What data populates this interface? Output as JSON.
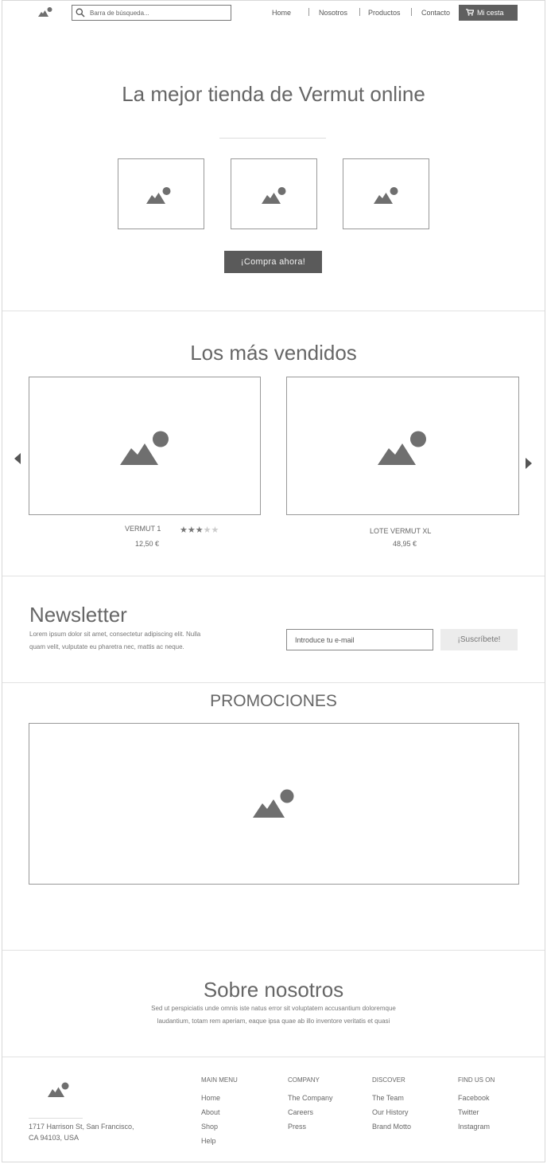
{
  "header": {
    "logo_icon": "image-placeholder-icon",
    "search_placeholder": "Barra de búsqueda...",
    "nav": [
      "Home",
      "Nosotros",
      "Productos",
      "Contacto"
    ],
    "cart_label": "Mi cesta",
    "cart_icon": "cart-icon"
  },
  "hero": {
    "title": "La mejor tienda de Vermut online",
    "cta": "¡Compra ahora!"
  },
  "bestsellers": {
    "title": "Los más vendidos",
    "products": [
      {
        "name": "VERMUT 1",
        "price": "12,50 €",
        "rating": 3,
        "rating_max": 5
      },
      {
        "name": "LOTE VERMUT XL",
        "price": "48,95 €"
      }
    ]
  },
  "newsletter": {
    "title": "Newsletter",
    "text_line1": "Lorem ipsum dolor sit amet, consectetur adipiscing elit. Nulla",
    "text_line2": "quam velit, vulputate eu pharetra nec, mattis ac neque.",
    "email_placeholder": "Introduce tu e-mail",
    "subscribe_label": "¡Suscríbete!"
  },
  "promos": {
    "title": "PROMOCIONES"
  },
  "about": {
    "title": "Sobre nosotros",
    "line1": "Sed ut perspiciatis unde omnis iste natus error sit voluptatem accusantium doloremque",
    "line2": "laudantium, totam rem aperiam, eaque ipsa quae ab illo inventore veritatis et quasi"
  },
  "footer": {
    "address_line1": "1717 Harrison St, San Francisco,",
    "address_line2": "CA 94103, USA",
    "columns": [
      {
        "heading": "MAIN MENU",
        "links": [
          "Home",
          "About",
          "Shop",
          "Help"
        ]
      },
      {
        "heading": "COMPANY",
        "links": [
          "The Company",
          "Careers",
          "Press"
        ]
      },
      {
        "heading": "DISCOVER",
        "links": [
          "The Team",
          "Our History",
          "Brand Motto"
        ]
      },
      {
        "heading": "FIND US ON",
        "links": [
          "Facebook",
          "Twitter",
          "Instagram"
        ]
      }
    ]
  },
  "colors": {
    "dark_button": "#5a5a5a",
    "light_button": "#ececec",
    "border": "#999999",
    "icon": "#6f6f6f",
    "star_on": "#777777",
    "star_off": "#cccccc"
  }
}
